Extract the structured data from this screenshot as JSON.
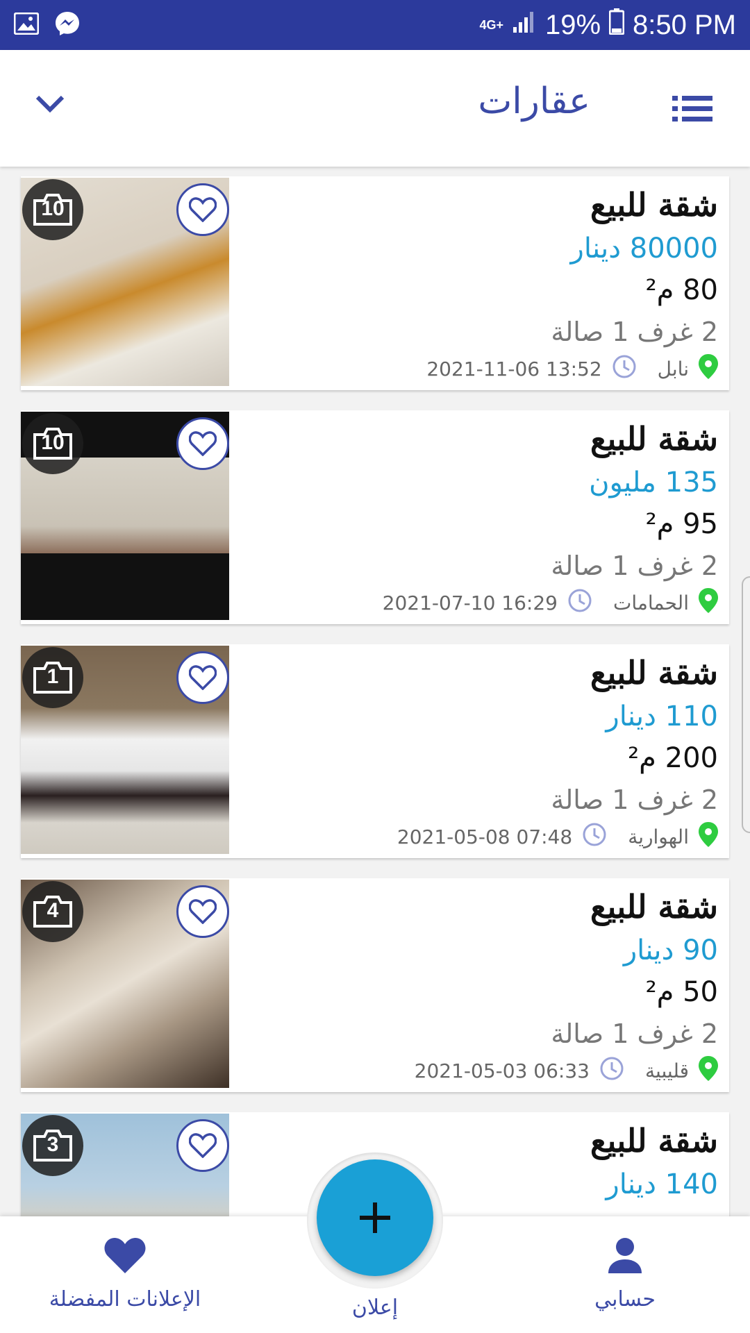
{
  "status_bar": {
    "network": "4G+",
    "battery": "19%",
    "time": "8:50 PM",
    "notification_icons": [
      "gallery-icon",
      "messenger-icon"
    ]
  },
  "app_bar": {
    "title": "عقارات"
  },
  "listings": [
    {
      "title": "شقة للبيع",
      "price": "80000 دينار",
      "area": "80 م²",
      "rooms": "2 غرف 1 صالة",
      "location": "نابل",
      "date": "2021-11-06 13:52",
      "photo_count": "10",
      "photo_colors": [
        "#d9cfc0",
        "#c98a2d",
        "#ece8df"
      ]
    },
    {
      "title": "شقة للبيع",
      "price": "135 مليون",
      "area": "95 م²",
      "rooms": "2 غرف 1 صالة",
      "location": "الحمامات",
      "date": "2021-07-10 16:29",
      "photo_count": "10",
      "photo_colors": [
        "#111111",
        "#c9c2b5",
        "#8d6f5c"
      ]
    },
    {
      "title": "شقة للبيع",
      "price": "110 دينار",
      "area": "200 م²",
      "rooms": "2 غرف 1 صالة",
      "location": "الهوارية",
      "date": "2021-05-08 07:48",
      "photo_count": "1",
      "photo_colors": [
        "#7a6650",
        "#f1f1f1",
        "#2a2020"
      ]
    },
    {
      "title": "شقة للبيع",
      "price": "90 دينار",
      "area": "50 م²",
      "rooms": "2 غرف 1 صالة",
      "location": "قليبية",
      "date": "2021-05-03 06:33",
      "photo_count": "4",
      "photo_colors": [
        "#6b5848",
        "#cfc3b2",
        "#3e3026"
      ]
    },
    {
      "title": "شقة للبيع",
      "price": "140 دينار",
      "area": "",
      "rooms": "",
      "location": "",
      "date": "",
      "photo_count": "3",
      "photo_colors": [
        "#9fc1da",
        "#d8cfc0",
        "#6f8a6a"
      ]
    }
  ],
  "bottom_nav": {
    "favorites_label": "الإعلانات المفضلة",
    "add_label": "إعلان",
    "account_label": "حسابي"
  },
  "colors": {
    "primary": "#3b4aa6",
    "status_bar": "#2c3a9c",
    "price": "#1f9bd1",
    "fab": "#1aa0d6",
    "location_pin": "#2ecc40"
  }
}
